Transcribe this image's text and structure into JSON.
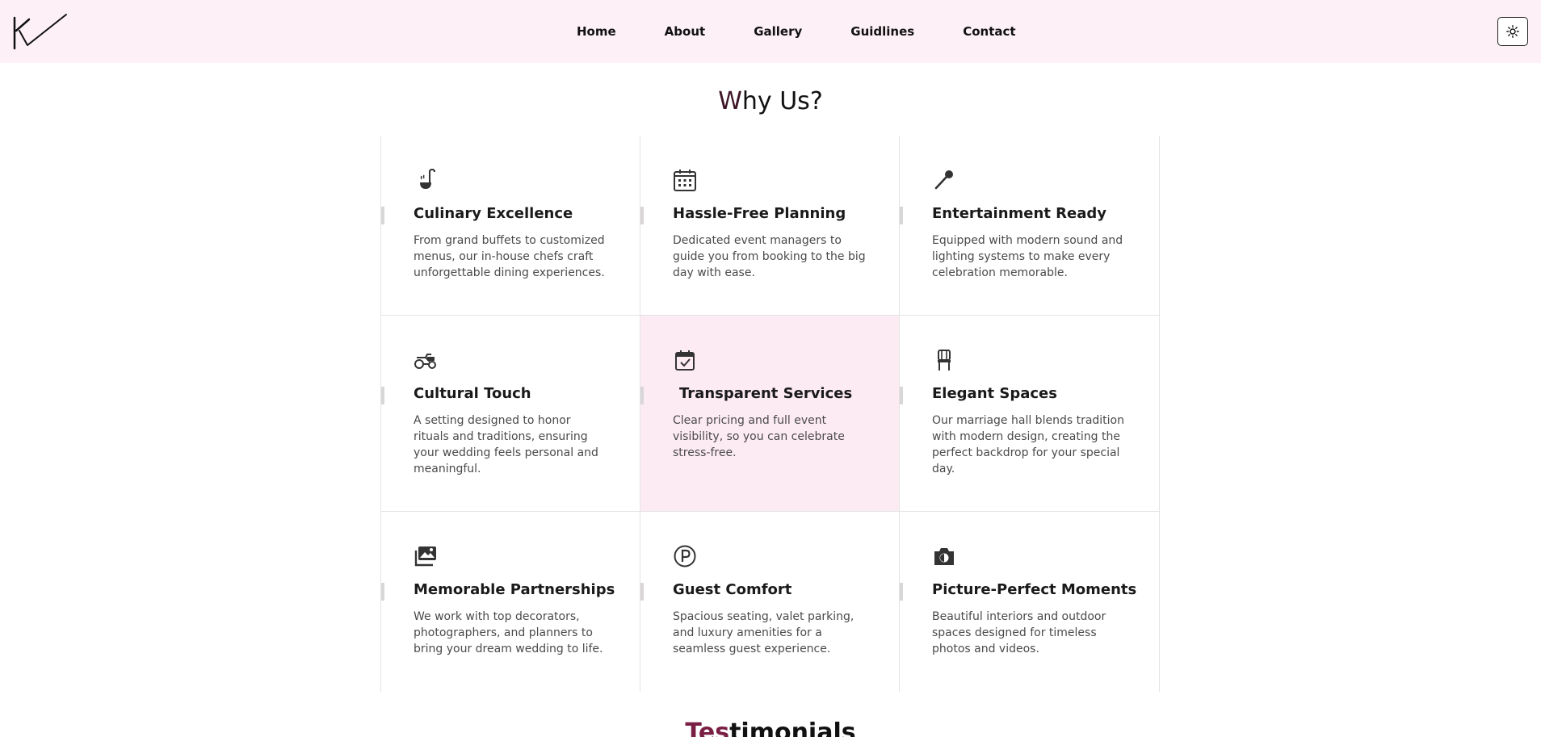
{
  "header": {
    "logo_alt": "logo",
    "nav": [
      "Home",
      "About",
      "Gallery",
      "Guidlines",
      "Contact"
    ],
    "theme_icon": "sun-icon"
  },
  "why_us": {
    "title_first": "W",
    "title_rest": "hy Us?",
    "features": [
      {
        "icon": "ladle-icon",
        "title": "Culinary Excellence",
        "desc": "From grand buffets to customized menus, our in-house chefs craft unforgettable dining experiences."
      },
      {
        "icon": "calendar-icon",
        "title": "Hassle-Free Planning",
        "desc": "Dedicated event managers to guide you from booking to the big day with ease."
      },
      {
        "icon": "microphone-icon",
        "title": "Entertainment Ready",
        "desc": "Equipped with modern sound and lighting systems to make every celebration memorable."
      },
      {
        "icon": "cart-icon",
        "title": "Cultural Touch",
        "desc": "A setting designed to honor rituals and traditions, ensuring your wedding feels personal and meaningful."
      },
      {
        "icon": "calendar-check-icon",
        "title": "Transparent Services",
        "desc": "Clear pricing and full event visibility, so you can celebrate stress-free."
      },
      {
        "icon": "chair-icon",
        "title": "Elegant Spaces",
        "desc": "Our marriage hall blends tradition with modern design, creating the perfect backdrop for your special day."
      },
      {
        "icon": "images-icon",
        "title": "Memorable Partnerships",
        "desc": "We work with top decorators, photographers, and planners to bring your dream wedding to life."
      },
      {
        "icon": "parking-icon",
        "title": "Guest Comfort",
        "desc": "Spacious seating, valet parking, and luxury amenities for a seamless guest experience."
      },
      {
        "icon": "camera-icon",
        "title": "Picture-Perfect Moments",
        "desc": "Beautiful interiors and outdoor spaces designed for timeless photos and videos."
      }
    ]
  },
  "testimonials": {
    "title_first": "Tes",
    "title_rest": "timonials"
  }
}
